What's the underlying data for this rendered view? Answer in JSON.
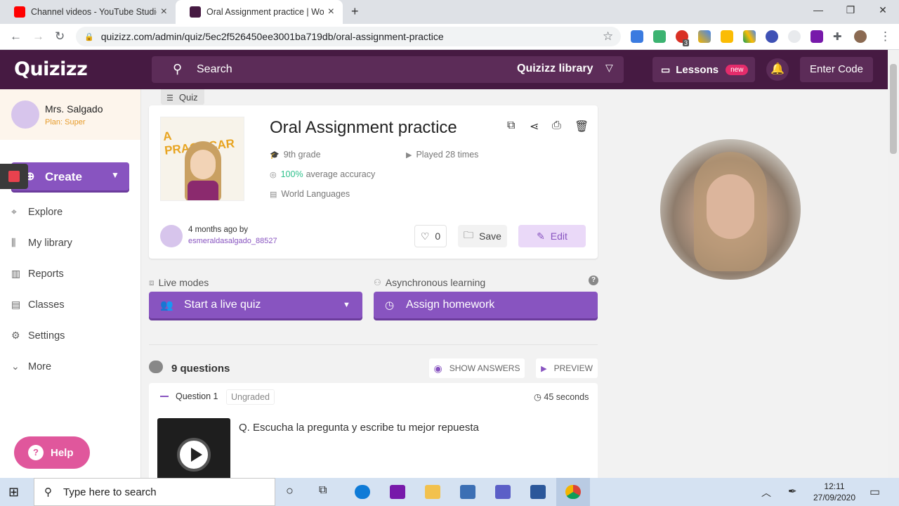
{
  "browser": {
    "tabs": [
      {
        "title": "Channel videos - YouTube Studio"
      },
      {
        "title": "Oral Assignment practice | World"
      }
    ],
    "url": "quizizz.com/admin/quiz/5ec2f526450ee3001ba719db/oral-assignment-practice",
    "ext_badge": "3"
  },
  "header": {
    "logo": "Quizizz",
    "search_label": "Search",
    "library_label": "Quizizz library",
    "lessons_label": "Lessons",
    "lessons_badge": "new",
    "enter_code_label": "Enter Code"
  },
  "sidebar": {
    "user_name": "Mrs. Salgado",
    "plan": "Plan: Super",
    "create_label": "Create",
    "items": [
      {
        "label": "Explore"
      },
      {
        "label": "My library"
      },
      {
        "label": "Reports"
      },
      {
        "label": "Classes"
      },
      {
        "label": "Settings"
      },
      {
        "label": "More"
      }
    ],
    "help_label": "Help"
  },
  "quiz": {
    "tag": "Quiz",
    "cover_text": "A PRACTICAR",
    "title": "Oral Assignment practice",
    "grade": "9th grade",
    "played": "Played 28 times",
    "accuracy_value": "100%",
    "accuracy_label": "average accuracy",
    "subject": "World Languages",
    "author_time": "4 months ago by",
    "author_name": "esmeraldasalgado_88527",
    "likes": "0",
    "save_label": "Save",
    "edit_label": "Edit"
  },
  "modes": {
    "live_heading": "Live modes",
    "live_button": "Start a live quiz",
    "async_heading": "Asynchronous learning",
    "async_button": "Assign homework"
  },
  "questions": {
    "count_label": "9 questions",
    "show_answers_label": "SHOW ANSWERS",
    "preview_label": "PREVIEW",
    "items": [
      {
        "number": "Question 1",
        "type": "Ungraded",
        "time": "45 seconds",
        "text": "Q. Escucha la pregunta y escribe tu mejor repuesta"
      }
    ]
  },
  "taskbar": {
    "search_placeholder": "Type here to search",
    "time": "12:11",
    "date": "27/09/2020"
  },
  "colors": {
    "header_bg": "#461a42",
    "accent": "#8854c0",
    "help": "#e0579c",
    "plan": "#e69b2a"
  }
}
